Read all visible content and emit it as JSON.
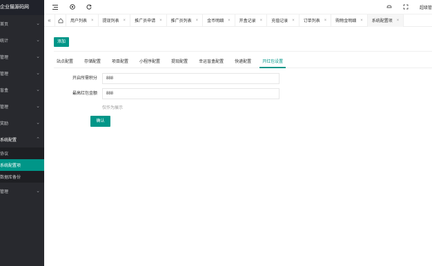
{
  "sidebar": {
    "logo": "企业猫源码网",
    "items": [
      {
        "label": "首页"
      },
      {
        "label": "统计"
      },
      {
        "label": "管理"
      },
      {
        "label": "管理"
      },
      {
        "label": "盲盒"
      },
      {
        "label": "管理"
      },
      {
        "label": "奖励"
      },
      {
        "label": "系统配置"
      }
    ],
    "subitems": [
      {
        "label": "协议"
      },
      {
        "label": "系统配置项"
      },
      {
        "label": "数据库备份"
      }
    ],
    "last_item": {
      "label": "管理"
    }
  },
  "header": {
    "icons": [
      "menu-fold-icon",
      "globe-icon",
      "refresh-icon",
      "theme-icon",
      "fullscreen-icon"
    ],
    "user": "超级管"
  },
  "tabs": [
    {
      "label": "用户列表"
    },
    {
      "label": "提现列表"
    },
    {
      "label": "推广员申请"
    },
    {
      "label": "推广员列表"
    },
    {
      "label": "金币明细"
    },
    {
      "label": "开盒记录"
    },
    {
      "label": "充值记录"
    },
    {
      "label": "订单列表"
    },
    {
      "label": "购物金明细"
    },
    {
      "label": "系统配置项"
    }
  ],
  "content": {
    "add_label": "添加",
    "subtabs": [
      "站点配置",
      "存储配置",
      "项目配置",
      "小程序配置",
      "提现配置",
      "幸运盲盒配置",
      "快递配置",
      "开红包设置"
    ],
    "fields": [
      {
        "label": "开启所需积分",
        "value": "888"
      },
      {
        "label": "最高红包金额",
        "value": "888"
      }
    ],
    "hint": "仅作为展示",
    "confirm_label": "确认"
  },
  "colors": {
    "accent": "#009688",
    "sidebar_bg": "#28292e"
  }
}
